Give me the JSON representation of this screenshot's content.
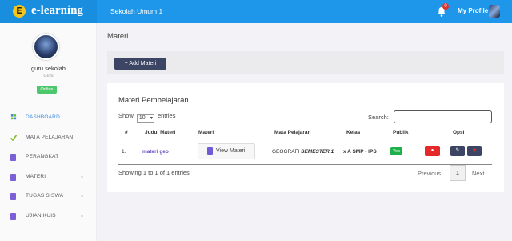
{
  "brand": {
    "badge": "E",
    "name": "e-learning"
  },
  "header": {
    "school": "Sekolah Umum 1",
    "notif_count": "0",
    "profile_label": "My Profile"
  },
  "user": {
    "name": "guru sekolah",
    "role": "Guru",
    "status": "Online"
  },
  "sidebar": {
    "items": [
      {
        "label": "DASHBOARD",
        "icon": "dashboard-icon",
        "color": "#3a8be0"
      },
      {
        "label": "MATA PELAJARAN",
        "icon": "check-icon",
        "color": "#7cbf2e"
      },
      {
        "label": "PERANGKAT",
        "icon": "document-icon",
        "color": "#7a5fd6"
      },
      {
        "label": "MATERI",
        "icon": "document-icon",
        "color": "#7a5fd6"
      },
      {
        "label": "TUGAS SISWA",
        "icon": "document-icon",
        "color": "#7a5fd6"
      },
      {
        "label": "UJIAN KUIS",
        "icon": "document-icon",
        "color": "#7a5fd6"
      }
    ]
  },
  "page": {
    "title": "Materi",
    "add_button": "+ Add Materi"
  },
  "table_card": {
    "title": "Materi Pembelajaran",
    "show_prefix": "Show",
    "show_value": "10",
    "show_suffix": "entries",
    "search_label": "Search:",
    "headers": [
      "#",
      "Judul Materi",
      "Materi",
      "Mata Pelajaran",
      "Kelas",
      "Publik",
      "Opsi"
    ],
    "rows": [
      {
        "no": "1.",
        "judul": "materi geo",
        "materi_button": "View Materi",
        "mapel": "GEOGRAFI",
        "semester": "SEMESTER 1",
        "kelas": "x A SMP - IPS",
        "publik": "Yes"
      }
    ],
    "info": "Showing 1 to 1 of 1 entries",
    "pagination": {
      "prev": "Previous",
      "current": "1",
      "next": "Next"
    }
  },
  "colors": {
    "topbar": "#1e97ea",
    "primary_dark": "#3c4664",
    "danger": "#e5292b",
    "success": "#1fb04a",
    "online": "#4cc76b"
  }
}
